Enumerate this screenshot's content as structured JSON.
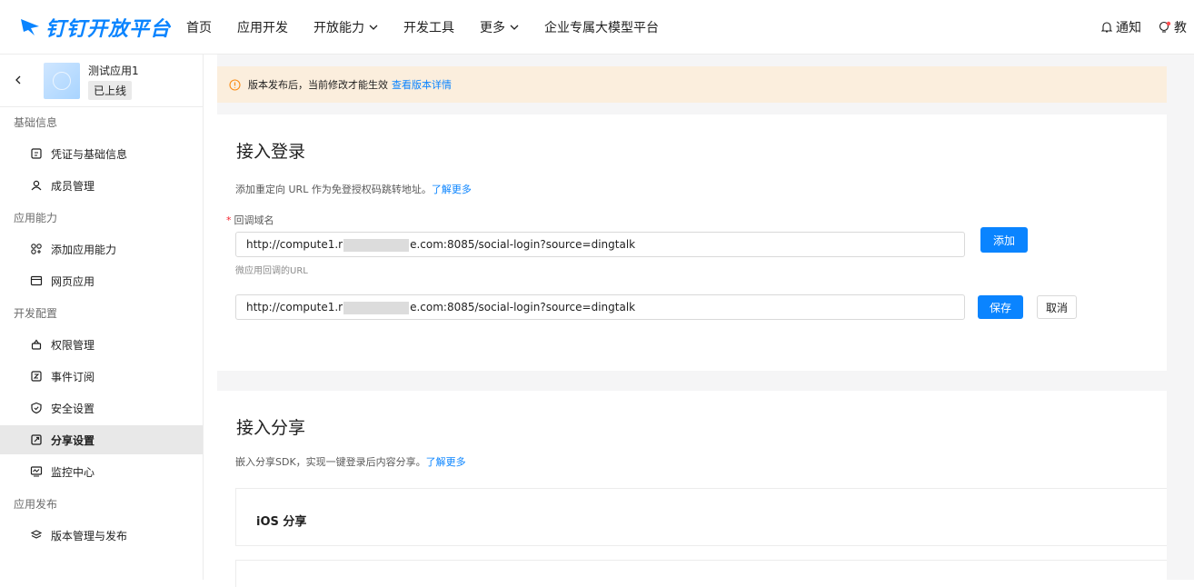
{
  "brand": {
    "name": "钉钉开放平台",
    "color": "#0a84ff"
  },
  "nav": {
    "items": [
      {
        "label": "首页",
        "dropdown": false
      },
      {
        "label": "应用开发",
        "dropdown": false
      },
      {
        "label": "开放能力",
        "dropdown": true
      },
      {
        "label": "开发工具",
        "dropdown": false
      },
      {
        "label": "更多",
        "dropdown": true
      },
      {
        "label": "企业专属大模型平台",
        "dropdown": false
      }
    ],
    "notify_label": "通知",
    "tutorial_label": "教"
  },
  "app": {
    "name": "测试应用1",
    "status": "已上线"
  },
  "sidebar": {
    "groups": [
      {
        "title": "基础信息",
        "items": [
          {
            "label": "凭证与基础信息",
            "icon": "credential-icon"
          },
          {
            "label": "成员管理",
            "icon": "user-icon"
          }
        ]
      },
      {
        "title": "应用能力",
        "items": [
          {
            "label": "添加应用能力",
            "icon": "apps-icon"
          },
          {
            "label": "网页应用",
            "icon": "webpage-icon"
          }
        ]
      },
      {
        "title": "开发配置",
        "items": [
          {
            "label": "权限管理",
            "icon": "lock-icon"
          },
          {
            "label": "事件订阅",
            "icon": "event-icon"
          },
          {
            "label": "安全设置",
            "icon": "shield-icon"
          },
          {
            "label": "分享设置",
            "icon": "share-icon",
            "active": true
          },
          {
            "label": "监控中心",
            "icon": "monitor-icon"
          }
        ]
      },
      {
        "title": "应用发布",
        "items": [
          {
            "label": "版本管理与发布",
            "icon": "layers-icon"
          }
        ]
      }
    ]
  },
  "notice": {
    "text": "版本发布后，当前修改才能生效",
    "link": "查看版本详情",
    "color": "#fbeedd"
  },
  "login_section": {
    "title": "接入登录",
    "desc": "添加重定向 URL 作为免登授权码跳转地址。",
    "desc_link": "了解更多",
    "field_label": "回调域名",
    "url1_prefix": "http://compute1.r",
    "url1_suffix": "e.com:8085/social-login?source=dingtalk",
    "add_button": "添加",
    "hint": "微应用回调的URL",
    "url2_prefix": "http://compute1.r",
    "url2_suffix": "e.com:8085/social-login?source=dingtalk",
    "save_button": "保存",
    "cancel_button": "取消"
  },
  "share_section": {
    "title": "接入分享",
    "desc": "嵌入分享SDK，实现一键登录后内容分享。",
    "desc_link": "了解更多",
    "ios_title": "iOS 分享"
  }
}
